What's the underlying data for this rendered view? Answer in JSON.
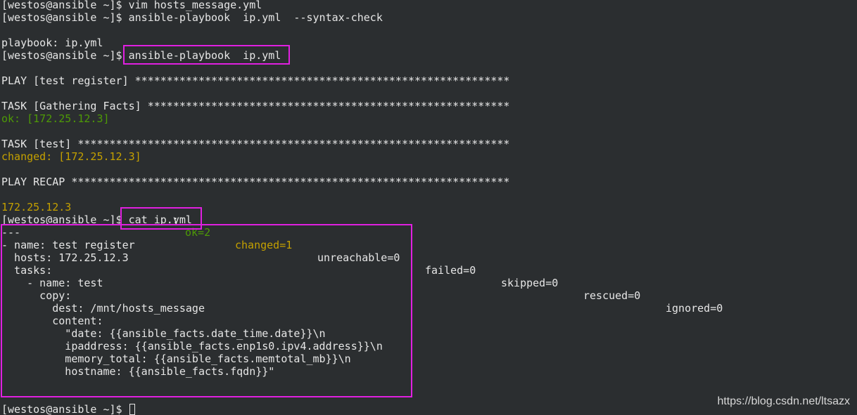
{
  "prompt": "[westos@ansible ~]$",
  "cmd1": "vim hosts_message.yml",
  "cmd2": "ansible-playbook  ip.yml  --syntax-check",
  "playbook_line": "playbook: ip.yml",
  "cmd3": "ansible-playbook  ip.yml",
  "play_header": "PLAY [test register] ***********************************************************",
  "task_gather": "TASK [Gathering Facts] *********************************************************",
  "ok_line": "ok: [172.25.12.3]",
  "task_test": "TASK [test] ********************************************************************",
  "changed_line": "changed: [172.25.12.3]",
  "recap_header": "PLAY RECAP *********************************************************************",
  "recap": {
    "host": "172.25.12.3",
    "sep": ": ",
    "ok": "ok=2",
    "changed": "changed=1",
    "unreachable": "unreachable=0",
    "failed": "failed=0",
    "skipped": "skipped=0",
    "rescued": "rescued=0",
    "ignored": "ignored=0"
  },
  "cmd4": "cat ip.yml",
  "file_lines": [
    "---",
    "- name: test register",
    "  hosts: 172.25.12.3",
    "  tasks:",
    "    - name: test",
    "      copy:",
    "        dest: /mnt/hosts_message",
    "        content:",
    "          \"date: {{ansible_facts.date_time.date}}\\n",
    "          ipaddress: {{ansible_facts.enp1s0.ipv4.address}}\\n",
    "          memory_total: {{ansible_facts.memtotal_mb}}\\n",
    "          hostname: {{ansible_facts.fqdn}}\""
  ],
  "watermark": "https://blog.csdn.net/ltsazx"
}
